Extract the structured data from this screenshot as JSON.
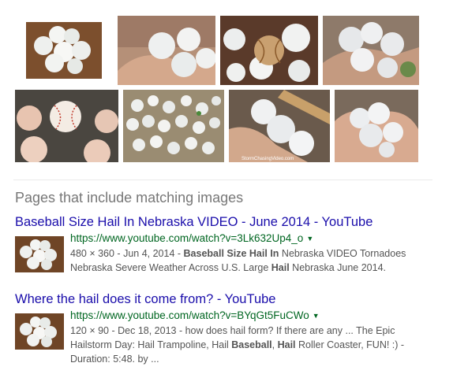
{
  "image_grid": [
    {
      "name": "hailstones-on-brown-cardboard"
    },
    {
      "name": "hailstones-in-hand"
    },
    {
      "name": "hailstones-with-baseball"
    },
    {
      "name": "hailstones-held-in-hand"
    },
    {
      "name": "hailstones-with-baseball-on-granite"
    },
    {
      "name": "many-hailstones-on-ground"
    },
    {
      "name": "hailstones-with-ruler-in-hand"
    },
    {
      "name": "hailstones-in-open-palm"
    }
  ],
  "watermark": "StormChasingVideo.com",
  "section_heading": "Pages that include matching images",
  "results": [
    {
      "title": "Baseball Size Hail In Nebraska VIDEO - June 2014 - YouTube",
      "url": "https://www.youtube.com/watch?v=3Lk632Up4_o",
      "line1_meta": "480 × 360 - Jun 4, 2014 - ",
      "line1_b1": "Baseball",
      "line1_t1": " ",
      "line1_b2": "Size Hail",
      "line1_t2": " ",
      "line1_b3": "In",
      "line1_t3": " Nebraska VIDEO Tornadoes",
      "line2_t1": "Nebraska Severe Weather Across U.S. Large ",
      "line2_b1": "Hail",
      "line2_t2": " Nebraska June 2014."
    },
    {
      "title": "Where the hail does it come from? - YouTube",
      "url": "https://www.youtube.com/watch?v=BYqGt5FuCWo",
      "line1_meta": "120 × 90 - Dec 18, 2013 - how does hail form? If there are any ... The Epic",
      "line2_t1": "Hailstorm Day: Hail Trampoline, Hail ",
      "line2_b1": "Baseball",
      "line2_t2": ", ",
      "line2_b2": "Hail",
      "line2_t3": " Roller Coaster, FUN! :) -",
      "line3": "Duration: 5:48. by ..."
    }
  ],
  "colors": {
    "title_link": "#1a0dab",
    "url": "#006621",
    "snippet": "#545454",
    "heading": "#777777"
  }
}
